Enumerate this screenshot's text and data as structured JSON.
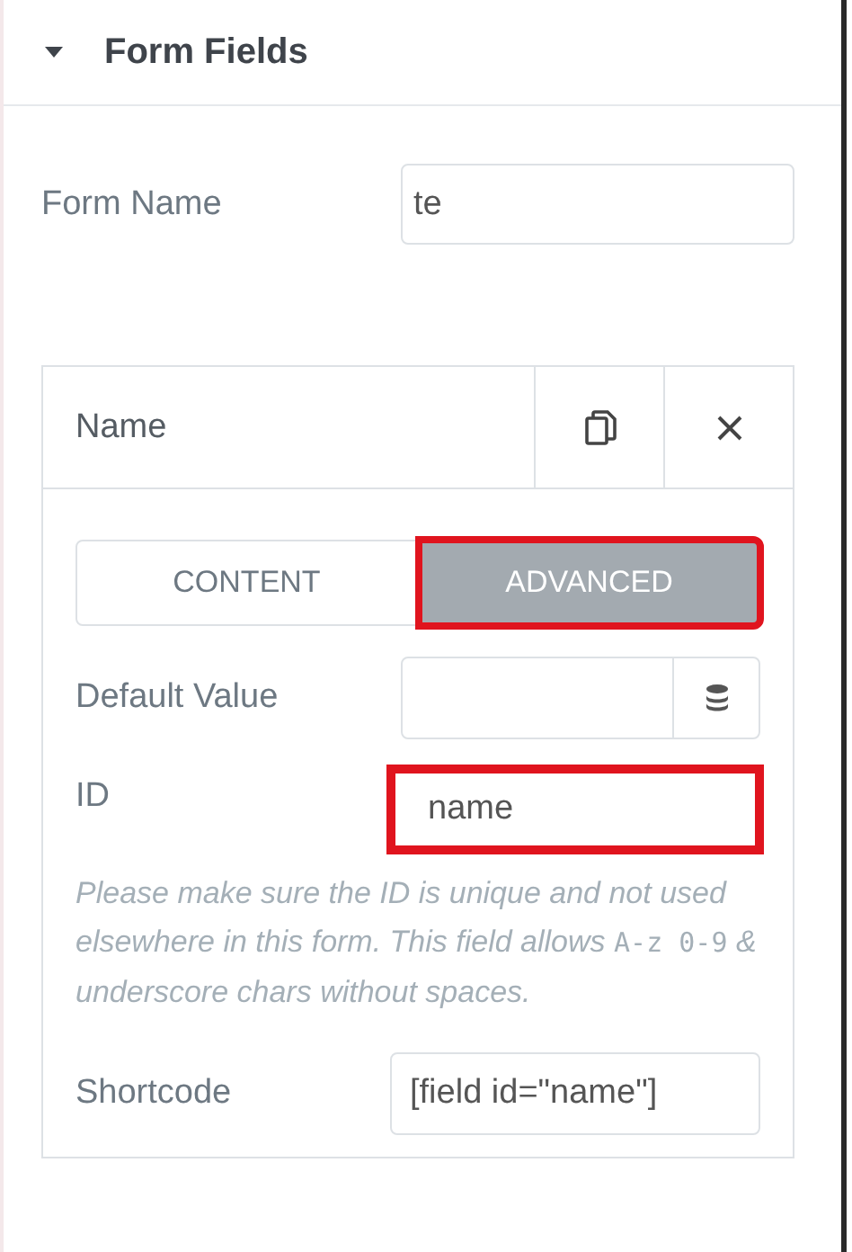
{
  "section": {
    "title": "Form Fields",
    "expanded": true
  },
  "form_name": {
    "label": "Form Name",
    "value": "te"
  },
  "field_item": {
    "title": "Name",
    "tabs": [
      {
        "label": "CONTENT",
        "selected": false,
        "highlighted": false
      },
      {
        "label": "ADVANCED",
        "selected": true,
        "highlighted": true
      }
    ],
    "default_value": {
      "label": "Default Value"
    },
    "id": {
      "label": "ID",
      "value": "name",
      "highlighted": true
    },
    "help": [
      {
        "kind": "text",
        "text": "Please make sure the ID is unique and not used elsewhere in this form. This field allows "
      },
      {
        "kind": "code",
        "text": "A-z 0-9"
      },
      {
        "kind": "text",
        "text": " & underscore chars without spaces."
      }
    ],
    "shortcode": {
      "label": "Shortcode",
      "value": "[field id=\"name\"]"
    }
  }
}
